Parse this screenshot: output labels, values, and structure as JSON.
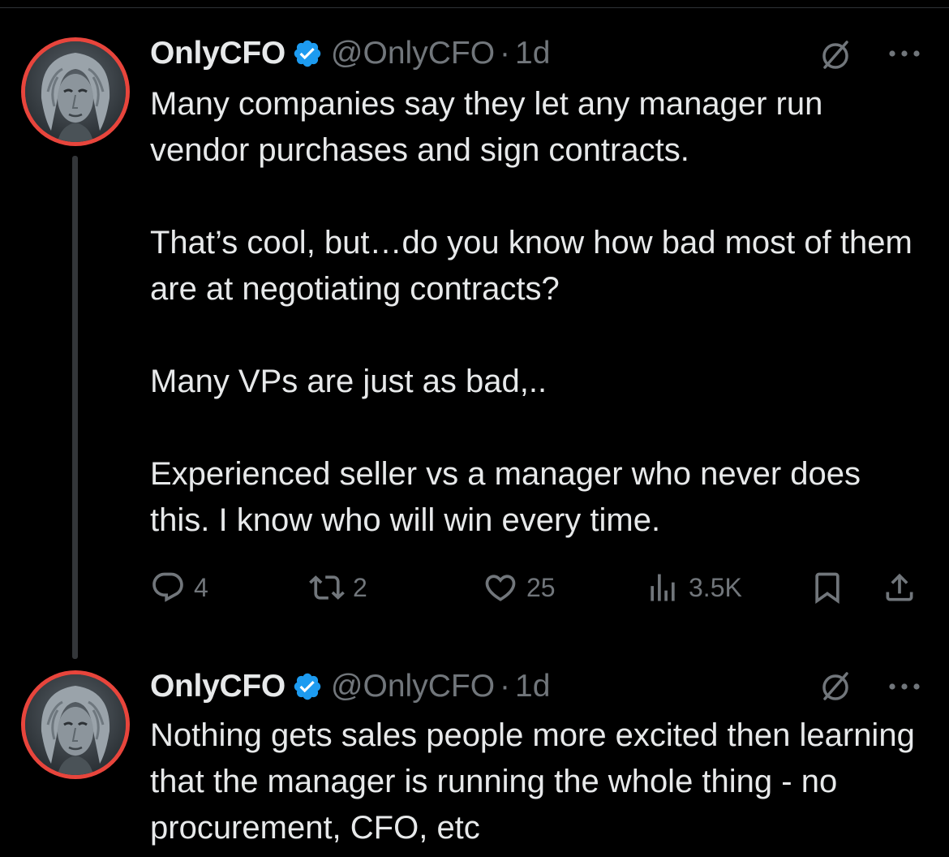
{
  "tweets": [
    {
      "display_name": "OnlyCFO",
      "handle": "@OnlyCFO",
      "separator": "·",
      "time": "1d",
      "paragraphs": [
        "Many companies say they let any manager run vendor purchases and sign contracts.",
        "That’s cool, but…do you know how bad most of them are at negotiating contracts?",
        "Many VPs are just as bad,..",
        "Experienced seller vs a manager who never does this. I know who will win every time."
      ],
      "stats": {
        "replies": "4",
        "retweets": "2",
        "likes": "25",
        "views": "3.5K"
      }
    },
    {
      "display_name": "OnlyCFO",
      "handle": "@OnlyCFO",
      "separator": "·",
      "time": "1d",
      "paragraphs": [
        "Nothing gets sales people more excited then learning that the manager is running the whole thing - no procurement, CFO, etc"
      ]
    }
  ],
  "colors": {
    "background": "#000000",
    "text": "#e7e9ea",
    "muted": "#71767b",
    "verified": "#1d9bf0",
    "avatar_ring": "#e8453c",
    "thread_line": "#333639"
  },
  "icons": {
    "verified": "verified-badge-icon",
    "grok": "grok-icon",
    "more": "more-dots-icon",
    "reply": "reply-icon",
    "retweet": "retweet-icon",
    "like": "heart-icon",
    "views": "views-chart-icon",
    "bookmark": "bookmark-icon",
    "share": "share-icon"
  }
}
